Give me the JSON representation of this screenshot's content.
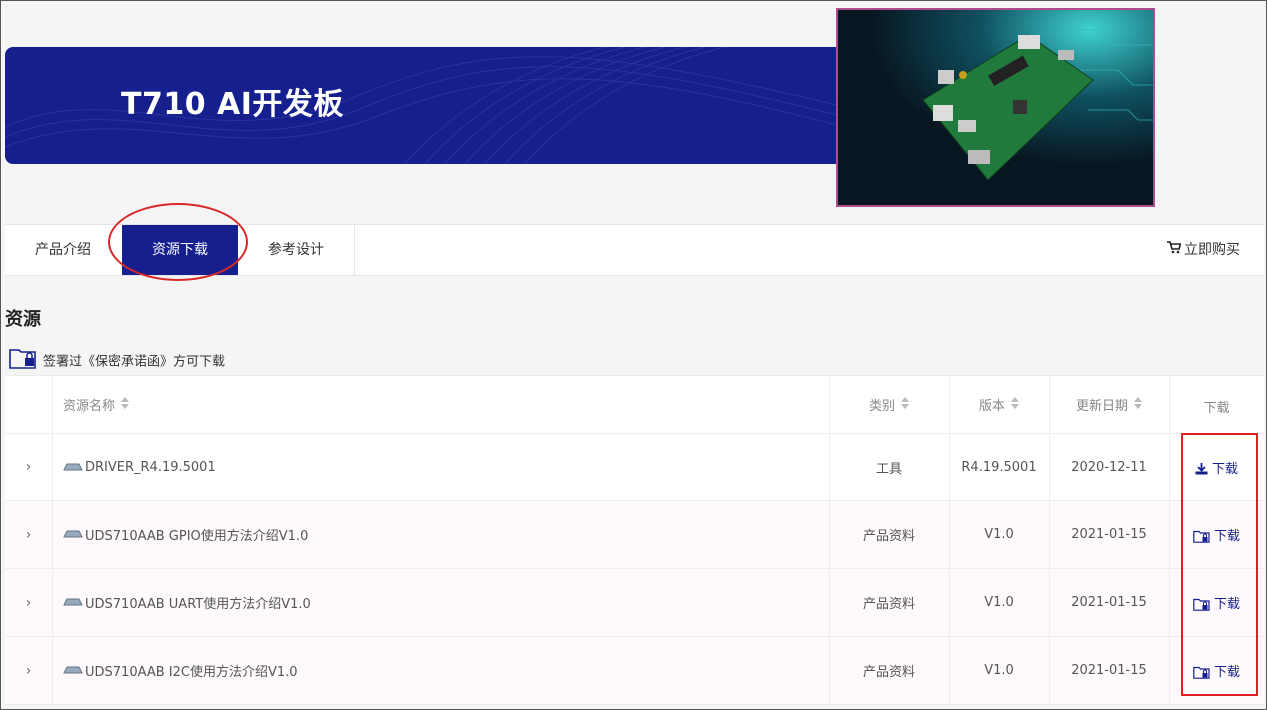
{
  "banner": {
    "title": "T710 AI开发板"
  },
  "tabs": [
    {
      "label": "产品介绍"
    },
    {
      "label": "资源下载",
      "active": true
    },
    {
      "label": "参考设计"
    }
  ],
  "buy_label": "立即购买",
  "section_title": "资源",
  "notice": "签署过《保密承诺函》方可下载",
  "table": {
    "headers": {
      "name": "资源名称",
      "category": "类别",
      "version": "版本",
      "date": "更新日期",
      "download": "下载"
    },
    "rows": [
      {
        "name": "DRIVER_R4.19.5001",
        "category": "工具",
        "version": "R4.19.5001",
        "date": "2020-12-11",
        "download": "下载",
        "locked": false
      },
      {
        "name": "UDS710AAB GPIO使用方法介绍V1.0",
        "category": "产品资料",
        "version": "V1.0",
        "date": "2021-01-15",
        "download": "下载",
        "locked": true
      },
      {
        "name": "UDS710AAB UART使用方法介绍V1.0",
        "category": "产品资料",
        "version": "V1.0",
        "date": "2021-01-15",
        "download": "下载",
        "locked": true
      },
      {
        "name": "UDS710AAB I2C使用方法介绍V1.0",
        "category": "产品资料",
        "version": "V1.0",
        "date": "2021-01-15",
        "download": "下载",
        "locked": true
      }
    ]
  },
  "colors": {
    "brand": "#151f8e",
    "highlight": "#e02020"
  },
  "icons": [
    "cart-icon",
    "lock-folder-icon",
    "sort-icon",
    "chevron-right-icon",
    "file-icon",
    "download-icon"
  ]
}
